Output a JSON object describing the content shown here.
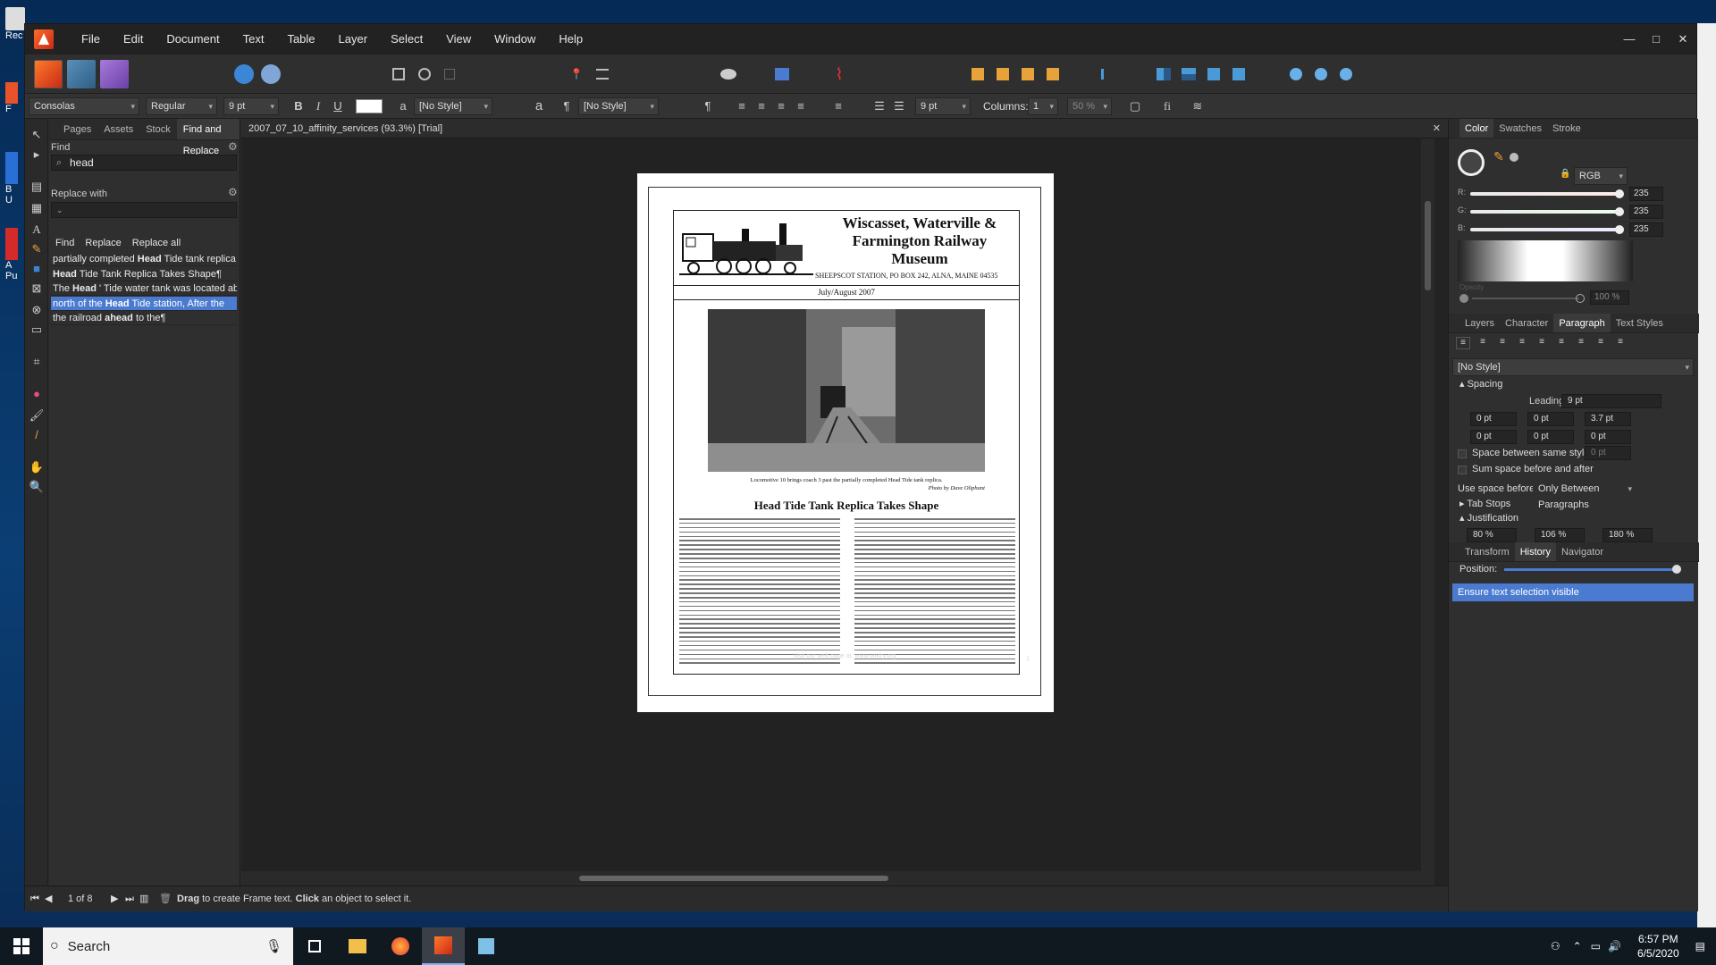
{
  "desktop": {
    "icons": [
      {
        "label": "Rec"
      },
      {
        "label": "F"
      },
      {
        "label": "B"
      },
      {
        "label": "U"
      },
      {
        "label": "A"
      },
      {
        "label": "Pu"
      }
    ]
  },
  "app": {
    "menu": [
      "File",
      "Edit",
      "Document",
      "Text",
      "Table",
      "Layer",
      "Select",
      "View",
      "Window",
      "Help"
    ],
    "window_controls": [
      "—",
      "□",
      "✕"
    ]
  },
  "context_bar": {
    "font": "Consolas",
    "style": "Regular",
    "size": "9 pt",
    "bold": "B",
    "italic": "I",
    "underline": "U",
    "char_style": "[No Style]",
    "para_style": "[No Style]",
    "leading": "9 pt",
    "columns_label": "Columns:",
    "columns_value": "1",
    "gutter": "50 %"
  },
  "find_replace": {
    "tabs": [
      "Pages",
      "Assets",
      "Stock",
      "Find and Replace"
    ],
    "find_label": "Find",
    "find_value": "head",
    "replace_label": "Replace with",
    "replace_value": "",
    "buttons": [
      "Find",
      "Replace",
      "Replace all"
    ],
    "results": [
      {
        "pre": "partially completed ",
        "match": "Head",
        "post": " Tide tank replica",
        "selected": false
      },
      {
        "pre": "",
        "match": "Head",
        "post": " Tide Tank Replica Takes Shape¶",
        "selected": false
      },
      {
        "pre": "The ",
        "match": "Head",
        "post": " ' Tide water tank was located about",
        "selected": false
      },
      {
        "pre": "north of the ",
        "match": "Head",
        "post": " Tide station, After the",
        "selected": true
      },
      {
        "pre": "the railroad ",
        "match": "ahead",
        "post": " to the¶",
        "selected": false
      }
    ]
  },
  "document": {
    "tab_title": "2007_07_10_affinity_services (93.3%) [Trial]",
    "masthead_title": "Wiscasset, Waterville & Farmington Railway Museum",
    "masthead_address": "SHEEPSCOT STATION, PO BOX 242, ALNA, MAINE 04535",
    "issue": "July/August 2007",
    "caption": "Locomotive 10 brings coach 3 past the partially completed Head Tide tank replica.",
    "credit": "Photo by Dave Oliphant",
    "headline": "Head Tide Tank Replica Takes Shape",
    "footer_url": "Visit our web page at: www.wwfry.org",
    "page_number": "1"
  },
  "status": {
    "page_indicator": "1 of 8",
    "hint_drag": "Drag",
    "hint_mid": " to create Frame text. ",
    "hint_click": "Click",
    "hint_end": " an object to select it."
  },
  "right_panel": {
    "color_tabs": [
      "Color",
      "Swatches",
      "Stroke"
    ],
    "color_model": "RGB",
    "r_label": "R:",
    "g_label": "G:",
    "b_label": "B:",
    "r": "235",
    "g": "235",
    "b": "235",
    "opacity_label": "Opacity",
    "opacity": "100 %",
    "para_tabs": [
      "Layers",
      "Character",
      "Paragraph",
      "Text Styles"
    ],
    "para_style": "[No Style]",
    "spacing_label": "Spacing",
    "leading_label": "Leading:",
    "leading": "9 pt",
    "indent_left": "0 pt",
    "indent_right": "0 pt",
    "first_line": "3.7 pt",
    "space_before": "0 pt",
    "space_after": "0 pt",
    "space_other": "0 pt",
    "space_between_label": "Space between same styles:",
    "space_between": "0 pt",
    "sum_space_label": "Sum space before and after",
    "use_space_label": "Use space before:",
    "use_space": "Only Between Paragraphs",
    "tab_stops": "Tab Stops",
    "justification": "Justification",
    "just_values": [
      "80 %",
      "106 %",
      "180 %"
    ],
    "history_tabs": [
      "Transform",
      "History",
      "Navigator"
    ],
    "position_label": "Position:",
    "history_item": "Ensure text selection visible"
  },
  "taskbar": {
    "search_placeholder": "Search",
    "time": "6:57 PM",
    "date": "6/5/2020"
  },
  "colors": {
    "accent": "#4a7bd0",
    "app_bg": "#2c2c2c",
    "affinity_orange": "#e8532a"
  }
}
